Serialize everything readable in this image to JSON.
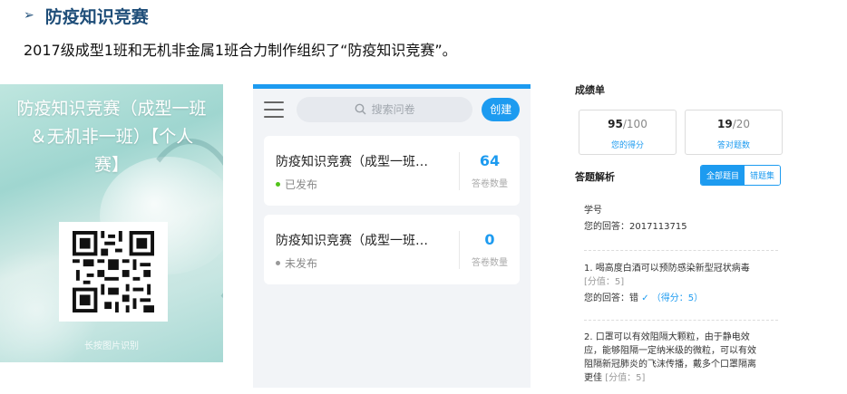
{
  "heading": {
    "arrow": "➢",
    "title": "防疫知识竞赛"
  },
  "subline": "2017级成型1班和无机非金属1班合力制作组织了“防疫知识竞赛”。",
  "poster": {
    "title_lines": [
      "防疫知识竞赛（成型一班",
      "＆无机非一班）【个人",
      "赛】"
    ],
    "caption": "长按图片识别"
  },
  "phone": {
    "search_placeholder": "搜索问卷",
    "create_label": "创建",
    "cards": [
      {
        "title": "防疫知识竞赛（成型一班…",
        "status": "已发布",
        "status_color": "#52c41a",
        "count": "64",
        "count_label": "答卷数量"
      },
      {
        "title": "防疫知识竞赛（成型一班…",
        "status": "未发布",
        "status_color": "#999999",
        "count": "0",
        "count_label": "答卷数量"
      }
    ]
  },
  "sheet": {
    "title": "成绩单",
    "score": {
      "value": "95",
      "total": "/100",
      "label": "您的得分"
    },
    "correct": {
      "value": "19",
      "total": "/20",
      "label": "答对题数"
    },
    "analysis_title": "答题解析",
    "tabs": [
      {
        "label": "全部题目",
        "active": true
      },
      {
        "label": "错题集",
        "active": false
      }
    ],
    "student_id_label": "学号",
    "student_answer": "您的回答：2017113715",
    "q1": {
      "text": "1. 喝高度白酒可以预防感染新型冠状病毒",
      "points": "[分值：5]",
      "answer_prefix": "您的回答：错",
      "check": "✓",
      "score": "（得分：5）"
    },
    "q2": {
      "line1": "2. 口罩可以有效阻隔大颗粒，由于静电效",
      "line2": "应，能够阻隔一定纳米级的微粒，可以有效",
      "line3": "阻隔新冠肺炎的飞沫传播，戴多个口罩隔离",
      "line4": "更佳",
      "points": "[分值：5]"
    }
  },
  "colors": {
    "accent": "#1d9bf0",
    "heading": "#1f4e79"
  }
}
